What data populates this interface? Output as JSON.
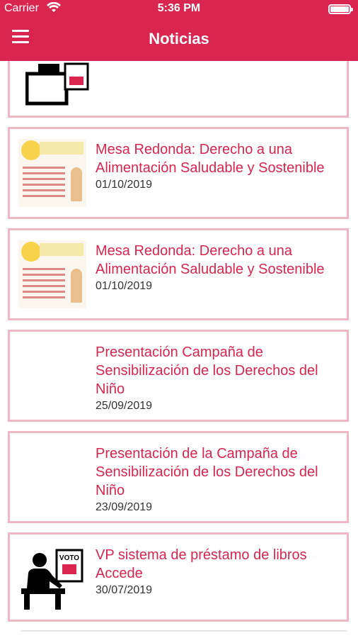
{
  "status_bar": {
    "carrier": "Carrier",
    "time": "5:36 PM"
  },
  "header": {
    "title": "Noticias"
  },
  "news": [
    {
      "headline": "Mesa Redonda: Derecho a una Alimentación Saludable y Sostenible",
      "date": "01/10/2019",
      "thumb": "poster"
    },
    {
      "headline": "Mesa Redonda: Derecho a una Alimentación Saludable y Sostenible",
      "date": "01/10/2019",
      "thumb": "poster"
    },
    {
      "headline": "Presentación Campaña de Sensibilización de los Derechos del Niño",
      "date": "25/09/2019",
      "thumb": "none"
    },
    {
      "headline": "Presentación de la Campaña de Sensibilización de los Derechos del Niño",
      "date": "23/09/2019",
      "thumb": "none"
    },
    {
      "headline": "VP sistema de préstamo de libros Accede",
      "date": "30/07/2019",
      "thumb": "voting-icon"
    }
  ],
  "voting_icon_text": "VOTO",
  "colors": {
    "accent": "#d9254f",
    "card_border": "#f2b7c5"
  }
}
